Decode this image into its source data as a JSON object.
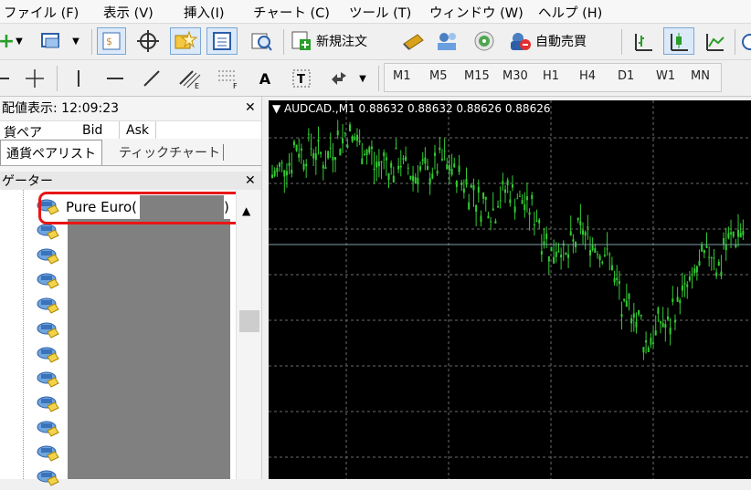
{
  "menu": [
    "ファイル (F)",
    "表示 (V)",
    "挿入(I)",
    "チャート (C)",
    "ツール (T)",
    "ウィンドウ (W)",
    "ヘルプ (H)"
  ],
  "toolbar": {
    "new_order_label": "新規注文",
    "auto_trade_label": "自動売買",
    "timeframes": [
      "M1",
      "M5",
      "M15",
      "M30",
      "H1",
      "H4",
      "D1",
      "W1",
      "MN"
    ]
  },
  "market_watch": {
    "header": "配値表示: 12:09:23",
    "columns": [
      "貨ペア",
      "Bid",
      "Ask"
    ],
    "tabs": [
      "通貨ペアリスト",
      "ティックチャート"
    ]
  },
  "navigator": {
    "title": "ゲーター",
    "items": [
      {
        "label": "Pure Euro(",
        "suffix": ")"
      },
      {
        "label": ""
      },
      {
        "label": ""
      },
      {
        "label": ""
      },
      {
        "label": ""
      },
      {
        "label": ""
      },
      {
        "label": ""
      },
      {
        "label": ""
      },
      {
        "label": ""
      },
      {
        "label": ""
      },
      {
        "label": ""
      },
      {
        "label": ""
      }
    ]
  },
  "chart": {
    "title": "AUDCAD.,M1  0.88632 0.88632 0.88626 0.88626",
    "candle_color": "#33cc33",
    "bg_color": "#000000",
    "grid_color": "#6b6b6b",
    "bid_line_color": "#7f9fa8",
    "series_close": [
      0.8862,
      0.8863,
      0.8864,
      0.8866,
      0.8865,
      0.8866,
      0.8865,
      0.8864,
      0.8866,
      0.8867,
      0.8868,
      0.8867,
      0.8866,
      0.8865,
      0.8863,
      0.8864,
      0.8863,
      0.8864,
      0.8863,
      0.8862,
      0.8863,
      0.8862,
      0.8863,
      0.8864,
      0.8863,
      0.8862,
      0.8861,
      0.886,
      0.8858,
      0.8858,
      0.8857,
      0.8859,
      0.886,
      0.8859,
      0.8858,
      0.8857,
      0.8856,
      0.8853,
      0.8851,
      0.8852,
      0.885,
      0.8852,
      0.8854,
      0.8853,
      0.8852,
      0.8851,
      0.885,
      0.8846,
      0.8842,
      0.8843,
      0.8841,
      0.8838,
      0.8839,
      0.8841,
      0.884,
      0.8843,
      0.8845,
      0.8846,
      0.8848,
      0.885,
      0.8851,
      0.8849,
      0.8852,
      0.8853,
      0.8854
    ]
  }
}
